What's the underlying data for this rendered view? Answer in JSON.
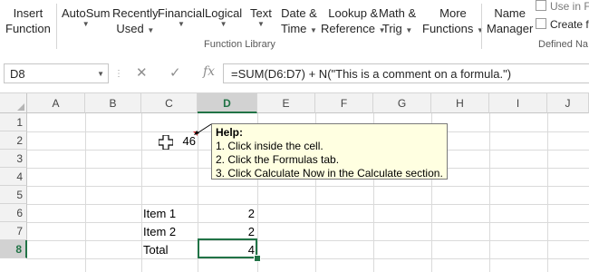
{
  "ribbon": {
    "buttons": [
      {
        "line1": "Insert",
        "line2": "Function",
        "dropdown": false
      },
      {
        "line1": "AutoSum",
        "line2": "",
        "dropdown": true
      },
      {
        "line1": "Recently",
        "line2": "Used",
        "dropdown": true
      },
      {
        "line1": "Financial",
        "line2": "",
        "dropdown": true
      },
      {
        "line1": "Logical",
        "line2": "",
        "dropdown": true
      },
      {
        "line1": "Text",
        "line2": "",
        "dropdown": true
      },
      {
        "line1": "Date &",
        "line2": "Time",
        "dropdown": true
      },
      {
        "line1": "Lookup &",
        "line2": "Reference",
        "dropdown": true
      },
      {
        "line1": "Math &",
        "line2": "Trig",
        "dropdown": true
      },
      {
        "line1": "More",
        "line2": "Functions",
        "dropdown": true
      },
      {
        "line1": "Name",
        "line2": "Manager",
        "dropdown": false
      }
    ],
    "group_function_library": "Function Library",
    "group_defined_names": "Defined Na",
    "small_use_in": "Use in F",
    "small_create": "Create fr"
  },
  "formula_bar": {
    "name_box": "D8",
    "cancel_icon": "✕",
    "enter_icon": "✓",
    "fx_label": "fx",
    "formula": "=SUM(D6:D7) + N(\"This is a comment on a formula.\")"
  },
  "grid": {
    "columns": [
      "A",
      "B",
      "C",
      "D",
      "E",
      "F",
      "G",
      "H",
      "I",
      "J"
    ],
    "selected_column": "D",
    "rows": [
      "1",
      "2",
      "3",
      "4",
      "5",
      "6",
      "7",
      "8"
    ],
    "selected_row": "8",
    "cells": {
      "C2": "46",
      "C6": "Item 1",
      "D6": "2",
      "C7": "Item 2",
      "D7": "2",
      "C8": "Total",
      "D8": "4"
    }
  },
  "comment": {
    "title": "Help:",
    "lines": [
      "1. Click inside the cell.",
      "2. Click the Formulas tab.",
      "3. Click Calculate Now in the Calculate section."
    ]
  },
  "colors": {
    "accent": "#217346",
    "comment_bg": "#ffffe1",
    "comment_indicator": "#d32f2f"
  }
}
